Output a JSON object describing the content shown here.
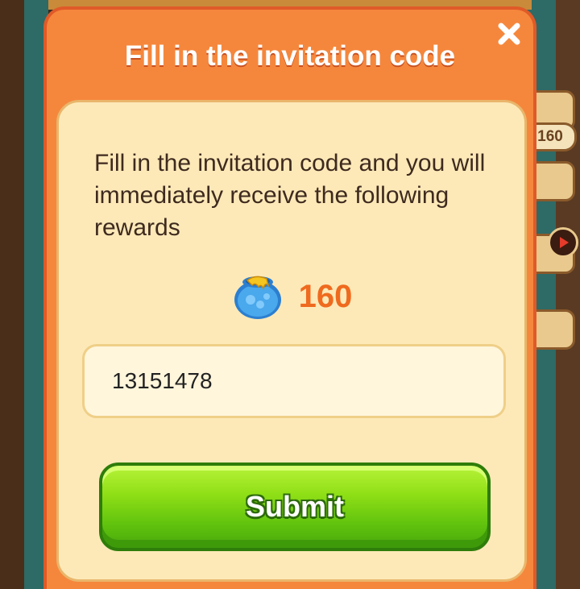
{
  "dialog": {
    "title": "Fill in the invitation code",
    "description": "Fill in the invitation code and you will immediately receive the following rewards",
    "reward": {
      "icon": "honey-pot-icon",
      "value": "160"
    },
    "code_input": {
      "value": "13151478",
      "placeholder": ""
    },
    "submit_label": "Submit",
    "close_icon": "close-icon"
  },
  "background": {
    "side_badge": "160"
  },
  "colors": {
    "dialog_orange": "#f5873c",
    "panel_cream": "#fde9b8",
    "reward_orange": "#ef6a1e",
    "submit_green": "#62c40e"
  }
}
